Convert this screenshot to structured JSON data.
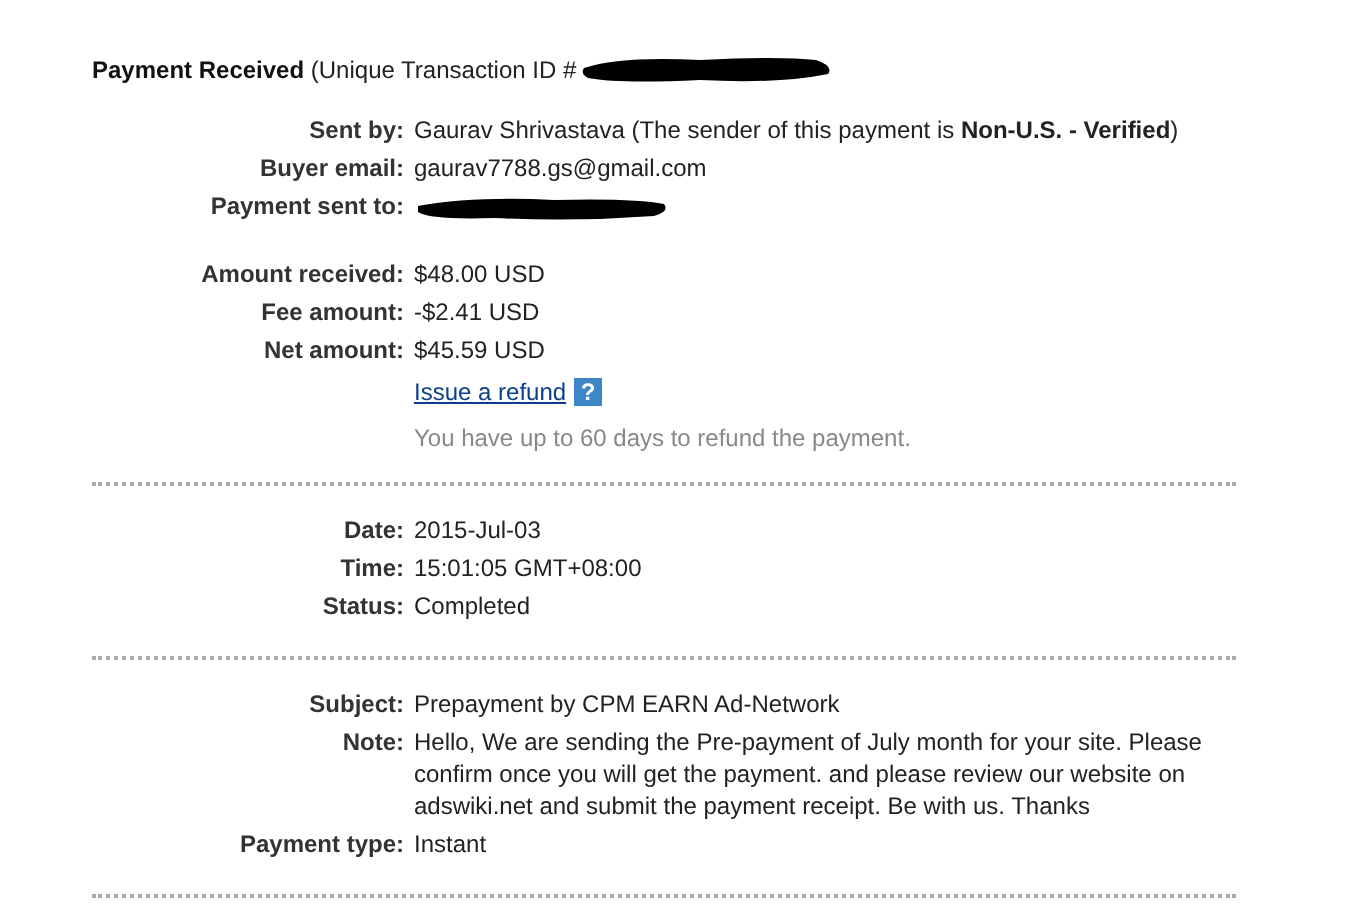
{
  "title": {
    "text": "**Payment Received** (Unique Transaction ID #",
    "redacted": true
  },
  "sections": [
    {
      "groups": [
        {
          "rows": [
            {
              "label": "Sent by:",
              "kind": "text",
              "value": "Gaurav Shrivastava (The sender of this payment is **Non-U.S. - Verified**)"
            },
            {
              "label": "Buyer email:",
              "kind": "text",
              "value": "gaurav7788.gs@gmail.com"
            },
            {
              "label": "Payment sent to:",
              "kind": "redacted"
            }
          ]
        },
        {
          "rows": [
            {
              "label": "Amount received:",
              "kind": "text",
              "value": "$48.00 USD"
            },
            {
              "label": "Fee amount:",
              "kind": "text",
              "value": "-$2.41 USD"
            },
            {
              "label": "Net amount:",
              "kind": "text",
              "value": "$45.59 USD"
            }
          ]
        }
      ],
      "refund": {
        "link": "Issue a refund",
        "help": "?",
        "hint": "You have up to 60 days to refund the payment."
      }
    },
    {
      "groups": [
        {
          "rows": [
            {
              "label": "Date:",
              "kind": "text",
              "value": "2015-Jul-03"
            },
            {
              "label": "Time:",
              "kind": "text",
              "value": "15:01:05 GMT+08:00"
            },
            {
              "label": "Status:",
              "kind": "text",
              "value": "Completed"
            }
          ]
        }
      ]
    },
    {
      "groups": [
        {
          "rows": [
            {
              "label": "Subject:",
              "kind": "text",
              "value": "Prepayment by CPM EARN Ad-Network"
            },
            {
              "label": "Note:",
              "kind": "text",
              "value": "Hello, We are sending the Pre-payment of July month for your site. Please confirm once you will get the payment. and please review our website on adswiki.net and submit the payment receipt. Be with us. Thanks"
            },
            {
              "label": "Payment type:",
              "kind": "text",
              "value": "Instant"
            }
          ]
        }
      ]
    }
  ]
}
